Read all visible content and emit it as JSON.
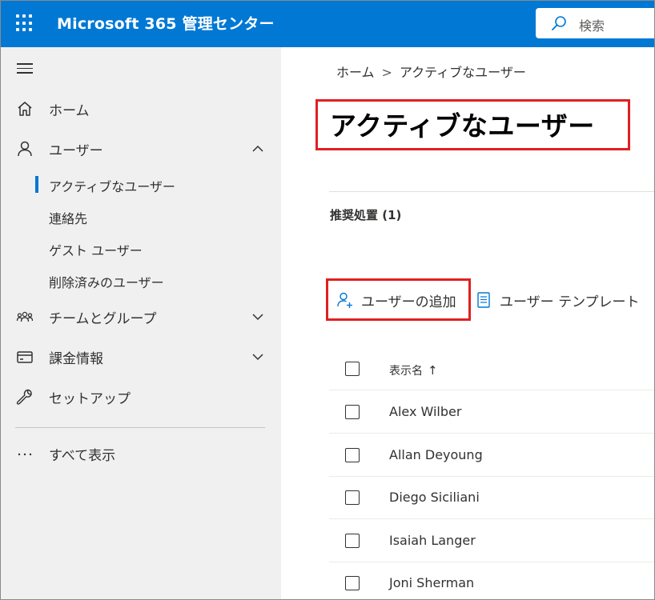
{
  "header": {
    "app_title": "Microsoft 365 管理センター",
    "search_placeholder": "検索",
    "brand_color": "#0078d4"
  },
  "sidebar": {
    "items": [
      {
        "label": "ホーム",
        "icon": "home-icon"
      },
      {
        "label": "ユーザー",
        "icon": "person-icon",
        "expanded": true
      },
      {
        "label": "チームとグループ",
        "icon": "people-team-icon"
      },
      {
        "label": "課金情報",
        "icon": "credit-card-icon"
      },
      {
        "label": "セットアップ",
        "icon": "wrench-icon"
      }
    ],
    "user_subitems": [
      {
        "label": "アクティブなユーザー",
        "selected": true
      },
      {
        "label": "連絡先"
      },
      {
        "label": "ゲスト ユーザー"
      },
      {
        "label": "削除済みのユーザー"
      }
    ],
    "show_all": "すべて表示"
  },
  "breadcrumb": {
    "home": "ホーム",
    "separator": ">",
    "current": "アクティブなユーザー"
  },
  "main": {
    "title": "アクティブなユーザー",
    "recommendations": "推奨処置 (1)",
    "commands": {
      "add_user": "ユーザーの追加",
      "user_template": "ユーザー テンプレート"
    }
  },
  "table": {
    "header": {
      "display_name": "表示名",
      "sort_indicator": "↑"
    },
    "rows": [
      {
        "display_name": "Alex Wilber"
      },
      {
        "display_name": "Allan Deyoung"
      },
      {
        "display_name": "Diego Siciliani"
      },
      {
        "display_name": "Isaiah Langer"
      },
      {
        "display_name": "Joni Sherman"
      }
    ]
  },
  "highlight_color": "#e02020"
}
